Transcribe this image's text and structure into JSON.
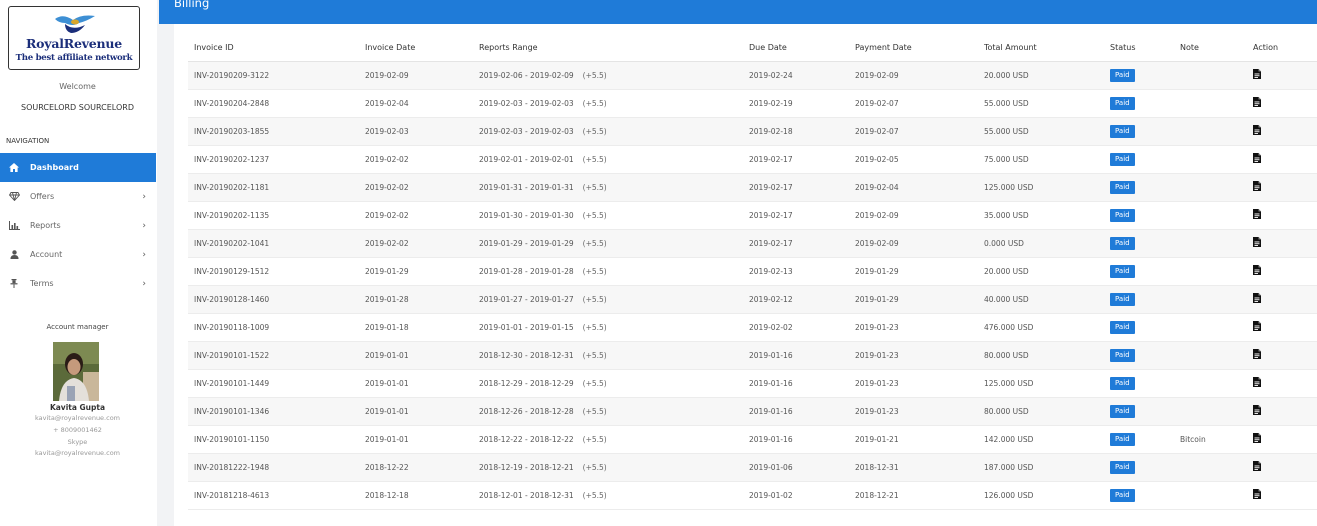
{
  "brand": {
    "name": "RoyalRevenue",
    "tagline": "The best affiliate network"
  },
  "user": {
    "welcome": "Welcome",
    "name": "SOURCELORD SOURCELORD"
  },
  "navigation": {
    "heading": "NAVIGATION",
    "items": [
      {
        "label": "Dashboard",
        "icon": "home-icon",
        "active": true,
        "has_submenu": false
      },
      {
        "label": "Offers",
        "icon": "diamond-icon",
        "active": false,
        "has_submenu": true
      },
      {
        "label": "Reports",
        "icon": "bar-chart-icon",
        "active": false,
        "has_submenu": true
      },
      {
        "label": "Account",
        "icon": "user-icon",
        "active": false,
        "has_submenu": true
      },
      {
        "label": "Terms",
        "icon": "pin-icon",
        "active": false,
        "has_submenu": true
      }
    ]
  },
  "account_manager": {
    "title": "Account manager",
    "name": "Kavita Gupta",
    "email": "kavita@royalrevenue.com",
    "phone": "+ 8009001462",
    "skype_label": "Skype",
    "skype": "kavita@royalrevenue.com"
  },
  "page": {
    "title": "Billing"
  },
  "table": {
    "columns": [
      "Invoice ID",
      "Invoice Date",
      "Reports Range",
      "Due Date",
      "Payment Date",
      "Total Amount",
      "Status",
      "Note",
      "Action"
    ],
    "rows": [
      {
        "invoice_id": "INV-20190209-3122",
        "invoice_date": "2019-02-09",
        "range": "2019-02-06 - 2019-02-09",
        "tz": "(+5.5)",
        "due_date": "2019-02-24",
        "payment_date": "2019-02-09",
        "amount": "20.000 USD",
        "status": "Paid",
        "note": ""
      },
      {
        "invoice_id": "INV-20190204-2848",
        "invoice_date": "2019-02-04",
        "range": "2019-02-03 - 2019-02-03",
        "tz": "(+5.5)",
        "due_date": "2019-02-19",
        "payment_date": "2019-02-07",
        "amount": "55.000 USD",
        "status": "Paid",
        "note": ""
      },
      {
        "invoice_id": "INV-20190203-1855",
        "invoice_date": "2019-02-03",
        "range": "2019-02-03 - 2019-02-03",
        "tz": "(+5.5)",
        "due_date": "2019-02-18",
        "payment_date": "2019-02-07",
        "amount": "55.000 USD",
        "status": "Paid",
        "note": ""
      },
      {
        "invoice_id": "INV-20190202-1237",
        "invoice_date": "2019-02-02",
        "range": "2019-02-01 - 2019-02-01",
        "tz": "(+5.5)",
        "due_date": "2019-02-17",
        "payment_date": "2019-02-05",
        "amount": "75.000 USD",
        "status": "Paid",
        "note": ""
      },
      {
        "invoice_id": "INV-20190202-1181",
        "invoice_date": "2019-02-02",
        "range": "2019-01-31 - 2019-01-31",
        "tz": "(+5.5)",
        "due_date": "2019-02-17",
        "payment_date": "2019-02-04",
        "amount": "125.000 USD",
        "status": "Paid",
        "note": ""
      },
      {
        "invoice_id": "INV-20190202-1135",
        "invoice_date": "2019-02-02",
        "range": "2019-01-30 - 2019-01-30",
        "tz": "(+5.5)",
        "due_date": "2019-02-17",
        "payment_date": "2019-02-09",
        "amount": "35.000 USD",
        "status": "Paid",
        "note": ""
      },
      {
        "invoice_id": "INV-20190202-1041",
        "invoice_date": "2019-02-02",
        "range": "2019-01-29 - 2019-01-29",
        "tz": "(+5.5)",
        "due_date": "2019-02-17",
        "payment_date": "2019-02-09",
        "amount": "0.000 USD",
        "status": "Paid",
        "note": ""
      },
      {
        "invoice_id": "INV-20190129-1512",
        "invoice_date": "2019-01-29",
        "range": "2019-01-28 - 2019-01-28",
        "tz": "(+5.5)",
        "due_date": "2019-02-13",
        "payment_date": "2019-01-29",
        "amount": "20.000 USD",
        "status": "Paid",
        "note": ""
      },
      {
        "invoice_id": "INV-20190128-1460",
        "invoice_date": "2019-01-28",
        "range": "2019-01-27 - 2019-01-27",
        "tz": "(+5.5)",
        "due_date": "2019-02-12",
        "payment_date": "2019-01-29",
        "amount": "40.000 USD",
        "status": "Paid",
        "note": ""
      },
      {
        "invoice_id": "INV-20190118-1009",
        "invoice_date": "2019-01-18",
        "range": "2019-01-01 - 2019-01-15",
        "tz": "(+5.5)",
        "due_date": "2019-02-02",
        "payment_date": "2019-01-23",
        "amount": "476.000 USD",
        "status": "Paid",
        "note": ""
      },
      {
        "invoice_id": "INV-20190101-1522",
        "invoice_date": "2019-01-01",
        "range": "2018-12-30 - 2018-12-31",
        "tz": "(+5.5)",
        "due_date": "2019-01-16",
        "payment_date": "2019-01-23",
        "amount": "80.000 USD",
        "status": "Paid",
        "note": ""
      },
      {
        "invoice_id": "INV-20190101-1449",
        "invoice_date": "2019-01-01",
        "range": "2018-12-29 - 2018-12-29",
        "tz": "(+5.5)",
        "due_date": "2019-01-16",
        "payment_date": "2019-01-23",
        "amount": "125.000 USD",
        "status": "Paid",
        "note": ""
      },
      {
        "invoice_id": "INV-20190101-1346",
        "invoice_date": "2019-01-01",
        "range": "2018-12-26 - 2018-12-28",
        "tz": "(+5.5)",
        "due_date": "2019-01-16",
        "payment_date": "2019-01-23",
        "amount": "80.000 USD",
        "status": "Paid",
        "note": ""
      },
      {
        "invoice_id": "INV-20190101-1150",
        "invoice_date": "2019-01-01",
        "range": "2018-12-22 - 2018-12-22",
        "tz": "(+5.5)",
        "due_date": "2019-01-16",
        "payment_date": "2019-01-21",
        "amount": "142.000 USD",
        "status": "Paid",
        "note": "Bitcoin"
      },
      {
        "invoice_id": "INV-20181222-1948",
        "invoice_date": "2018-12-22",
        "range": "2018-12-19 - 2018-12-21",
        "tz": "(+5.5)",
        "due_date": "2019-01-06",
        "payment_date": "2018-12-31",
        "amount": "187.000 USD",
        "status": "Paid",
        "note": ""
      },
      {
        "invoice_id": "INV-20181218-4613",
        "invoice_date": "2018-12-18",
        "range": "2018-12-01 - 2018-12-31",
        "tz": "(+5.5)",
        "due_date": "2019-01-02",
        "payment_date": "2018-12-21",
        "amount": "126.000 USD",
        "status": "Paid",
        "note": ""
      }
    ]
  },
  "colors": {
    "accent": "#1f7bd8",
    "brand_text": "#1b2e7a"
  }
}
